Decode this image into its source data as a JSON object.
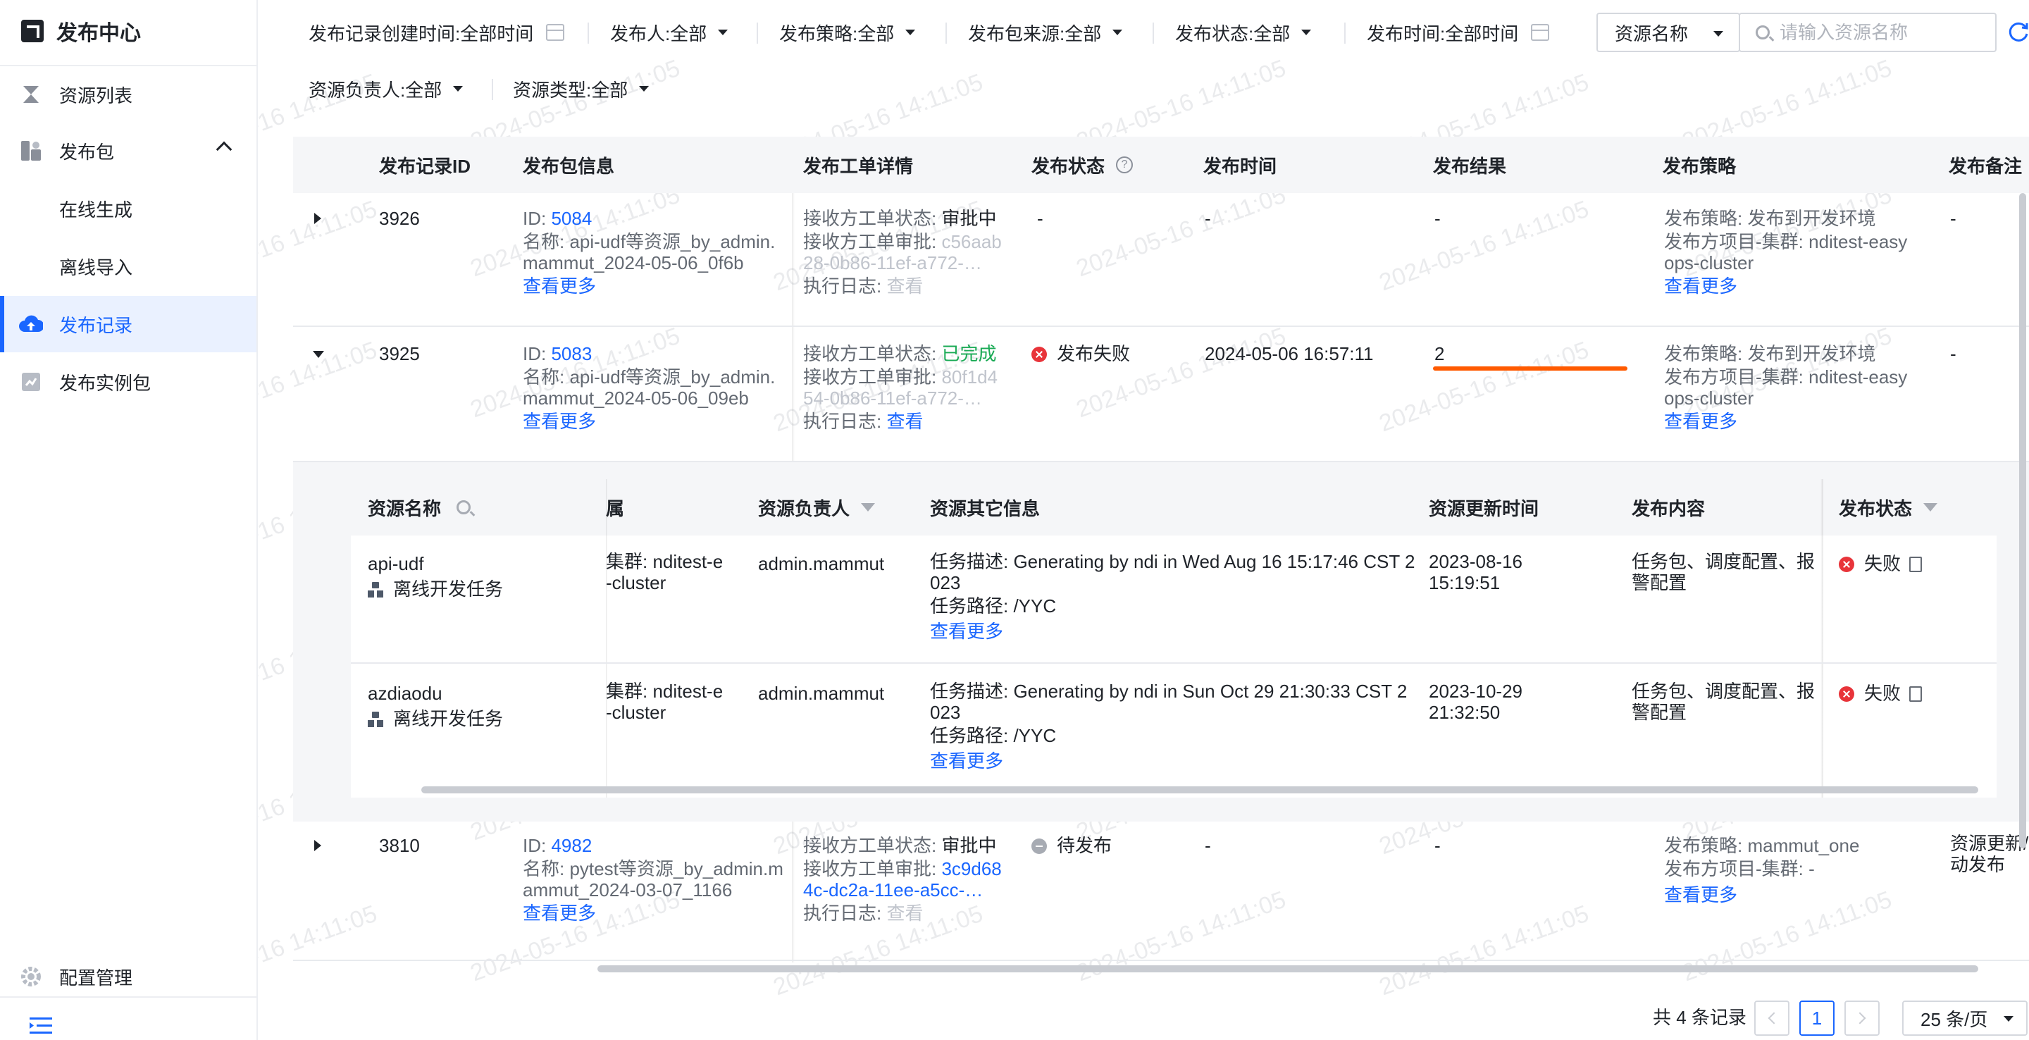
{
  "app": {
    "title": "发布中心"
  },
  "sidebar": {
    "items": [
      {
        "label": "资源列表",
        "icon": "hourglass-icon"
      },
      {
        "label": "发布包",
        "icon": "package-icon"
      },
      {
        "label": "在线生成"
      },
      {
        "label": "离线导入"
      },
      {
        "label": "发布记录",
        "icon": "cloud-upload-icon"
      },
      {
        "label": "发布实例包",
        "icon": "instance-package-icon"
      }
    ],
    "config": "配置管理"
  },
  "filters": {
    "created_time": {
      "label": "发布记录创建时间:",
      "value": "全部时间"
    },
    "publisher": {
      "label": "发布人:",
      "value": "全部"
    },
    "strategy": {
      "label": "发布策略:",
      "value": "全部"
    },
    "source": {
      "label": "发布包来源:",
      "value": "全部"
    },
    "status": {
      "label": "发布状态:",
      "value": "全部"
    },
    "publish_time": {
      "label": "发布时间:",
      "value": "全部时间"
    },
    "owner": {
      "label": "资源负责人:",
      "value": "全部"
    },
    "res_type": {
      "label": "资源类型:",
      "value": "全部"
    },
    "search_field": "资源名称",
    "search_placeholder": "请输入资源名称"
  },
  "table": {
    "headers": [
      "发布记录ID",
      "发布包信息",
      "发布工单详情",
      "发布状态",
      "发布时间",
      "发布结果",
      "发布策略",
      "发布备注"
    ],
    "rows": [
      {
        "id": "3926",
        "pkg_id_label": "ID:",
        "pkg_id": "5084",
        "pkg_name_1": "名称: api-udf等资源_by_admin.",
        "pkg_name_2": "mammut_2024-05-06_0f6b",
        "more": "查看更多",
        "ticket_status_label": "接收方工单状态:",
        "ticket_status": "审批中",
        "ticket_approve_label": "接收方工单审批:",
        "ticket_approve_1": "c56aab",
        "ticket_approve_2": "28-0b86-11ef-a772-…",
        "log_label": "执行日志:",
        "log": "查看",
        "status": "-",
        "time": "-",
        "result": "-",
        "strategy_1": "发布策略: 发布到开发环境",
        "strategy_2": "发布方项目-集群: nditest-easy",
        "strategy_3": "ops-cluster",
        "remark": "-"
      },
      {
        "id": "3925",
        "pkg_id_label": "ID:",
        "pkg_id": "5083",
        "pkg_name_1": "名称: api-udf等资源_by_admin.",
        "pkg_name_2": "mammut_2024-05-06_09eb",
        "more": "查看更多",
        "ticket_status_label": "接收方工单状态:",
        "ticket_status": "已完成",
        "ticket_approve_label": "接收方工单审批:",
        "ticket_approve_1": "80f1d4",
        "ticket_approve_2": "54-0b86-11ef-a772-…",
        "log_label": "执行日志:",
        "log": "查看",
        "status": "发布失败",
        "time": "2024-05-06 16:57:11",
        "result": "2",
        "strategy_1": "发布策略: 发布到开发环境",
        "strategy_2": "发布方项目-集群: nditest-easy",
        "strategy_3": "ops-cluster",
        "remark": "-"
      },
      {
        "id": "3810",
        "pkg_id_label": "ID:",
        "pkg_id": "4982",
        "pkg_name_1": "名称: pytest等资源_by_admin.m",
        "pkg_name_2": "ammut_2024-03-07_1166",
        "more": "查看更多",
        "ticket_status_label": "接收方工单状态:",
        "ticket_status": "审批中",
        "ticket_approve_label": "接收方工单审批:",
        "ticket_approve_1": "3c9d68",
        "ticket_approve_2": "4c-dc2a-11ee-a5cc-…",
        "log_label": "执行日志:",
        "log": "查看",
        "status": "待发布",
        "time": "-",
        "result": "-",
        "strategy_1": "发布策略: mammut_one",
        "strategy_2": "发布方项目-集群: -",
        "strategy_3": "",
        "remark_1": "资源更新/",
        "remark_2": "动发布"
      }
    ]
  },
  "nested": {
    "headers": [
      "资源名称",
      "属",
      "资源负责人",
      "资源其它信息",
      "资源更新时间",
      "发布内容",
      "发布状态"
    ],
    "rows": [
      {
        "name": "api-udf",
        "type": "离线开发任务",
        "cluster_1": "集群: nditest-e",
        "cluster_2": "-cluster",
        "owner": "admin.mammut",
        "desc_1": "任务描述: Generating by ndi in Wed Aug 16 15:17:46 CST 2",
        "desc_2": "023",
        "path": "任务路径: /YYC",
        "more": "查看更多",
        "updated_1": "2023-08-16",
        "updated_2": "15:19:51",
        "content_1": "任务包、调度配置、报",
        "content_2": "警配置",
        "status": "失败"
      },
      {
        "name": "azdiaodu",
        "type": "离线开发任务",
        "cluster_1": "集群: nditest-e",
        "cluster_2": "-cluster",
        "owner": "admin.mammut",
        "desc_1": "任务描述: Generating by ndi in Sun Oct 29 21:30:33 CST 2",
        "desc_2": "023",
        "path": "任务路径: /YYC",
        "more": "查看更多",
        "updated_1": "2023-10-29",
        "updated_2": "21:32:50",
        "content_1": "任务包、调度配置、报",
        "content_2": "警配置",
        "status": "失败"
      }
    ]
  },
  "pagination": {
    "total": "共 4 条记录",
    "page": "1",
    "page_size": "25 条/页"
  },
  "watermark": "2024-05-16 14:11:05",
  "colors": {
    "accent": "#1a66ff",
    "success": "#1aaa55",
    "error": "#e8343a",
    "highlight": "#ff5a00"
  }
}
